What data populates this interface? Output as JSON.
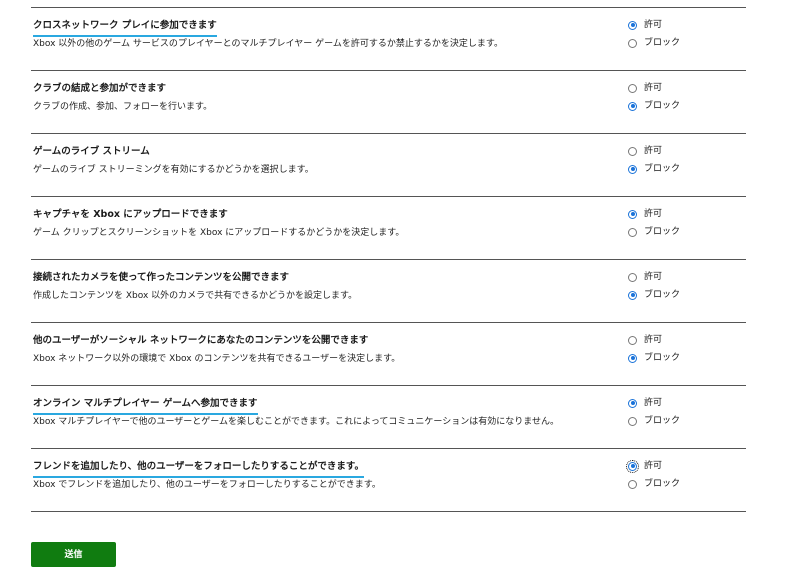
{
  "settings": [
    {
      "title": "クロスネットワーク プレイに参加できます",
      "description": "Xbox 以外の他のゲーム サービスのプレイヤーとのマルチプレイヤー ゲームを許可するか禁止するかを決定します。",
      "highlighted": true,
      "options": [
        "許可",
        "ブロック"
      ],
      "selected": "許可",
      "focused": false
    },
    {
      "title": "クラブの結成と参加ができます",
      "description": "クラブの作成、参加、フォローを行います。",
      "highlighted": false,
      "options": [
        "許可",
        "ブロック"
      ],
      "selected": "ブロック",
      "focused": false
    },
    {
      "title": "ゲームのライブ ストリーム",
      "description": "ゲームのライブ ストリーミングを有効にするかどうかを選択します。",
      "highlighted": false,
      "options": [
        "許可",
        "ブロック"
      ],
      "selected": "ブロック",
      "focused": false
    },
    {
      "title": "キャプチャを Xbox にアップロードできます",
      "description": "ゲーム クリップとスクリーンショットを Xbox にアップロードするかどうかを決定します。",
      "highlighted": false,
      "options": [
        "許可",
        "ブロック"
      ],
      "selected": "許可",
      "focused": false
    },
    {
      "title": "接続されたカメラを使って作ったコンテンツを公開できます",
      "description": "作成したコンテンツを Xbox 以外のカメラで共有できるかどうかを設定します。",
      "highlighted": false,
      "options": [
        "許可",
        "ブロック"
      ],
      "selected": "ブロック",
      "focused": false
    },
    {
      "title": "他のユーザーがソーシャル ネットワークにあなたのコンテンツを公開できます",
      "description": "Xbox ネットワーク以外の環境で Xbox のコンテンツを共有できるユーザーを決定します。",
      "highlighted": false,
      "options": [
        "許可",
        "ブロック"
      ],
      "selected": "ブロック",
      "focused": false
    },
    {
      "title": "オンライン マルチプレイヤー ゲームへ参加できます",
      "description": "Xbox マルチプレイヤーで他のユーザーとゲームを楽しむことができます。これによってコミュニケーションは有効になりません。",
      "highlighted": true,
      "options": [
        "許可",
        "ブロック"
      ],
      "selected": "許可",
      "focused": false
    },
    {
      "title": "フレンドを追加したり、他のユーザーをフォローしたりすることができます。",
      "description": "Xbox でフレンドを追加したり、他のユーザーをフォローしたりすることができます。",
      "highlighted": true,
      "options": [
        "許可",
        "ブロック"
      ],
      "selected": "許可",
      "focused": true
    }
  ],
  "submit": {
    "label": "送信"
  },
  "colors": {
    "accent_underline": "#2aa8e0",
    "radio_selected": "#1a73d9",
    "submit_button": "#107c10",
    "divider": "#555555"
  }
}
